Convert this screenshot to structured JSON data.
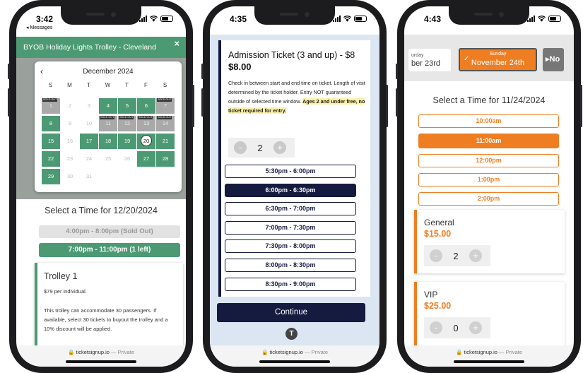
{
  "phone1": {
    "status": {
      "time": "3:42",
      "back_app": "◂ Messages"
    },
    "header": {
      "title": "BYOB Holiday Lights Trolley - Cleveland",
      "close": "×"
    },
    "calendar": {
      "month": "December 2024",
      "prev": "‹",
      "weekdays": [
        "S",
        "M",
        "T",
        "W",
        "T",
        "F",
        "S"
      ],
      "sold_out_label": "SOLD OUT",
      "days": [
        "1",
        "2",
        "3",
        "4",
        "5",
        "6",
        "7",
        "8",
        "9",
        "10",
        "11",
        "12",
        "13",
        "14",
        "15",
        "16",
        "17",
        "18",
        "19",
        "20",
        "21",
        "22",
        "23",
        "24",
        "25",
        "26",
        "27",
        "28",
        "29",
        "30",
        "31"
      ]
    },
    "select_time": "Select a Time for 12/20/2024",
    "slots": {
      "soldout": "4:00pm - 8:00pm (Sold Out)",
      "available": "7:00pm - 11:00pm (1 left)"
    },
    "trolley": {
      "title": "Trolley 1",
      "price_note": "$79 per individual.",
      "desc": "This trolley can accommodate 30 passengers. If available, select 30 tickets to buyout the trolley and a 10% discount will be applied."
    },
    "url": {
      "domain": "ticketsignup.io",
      "suffix": "— Private"
    }
  },
  "phone2": {
    "status": {
      "time": "4:35"
    },
    "ticket": {
      "title": "Admission Ticket (3 and up) - $8",
      "price": "$8.00",
      "desc": "Check in between start and end time on ticket. Length of visit determined by the ticket holder. Entry NOT guaranteed outside of selected time window.",
      "highlight": "Ages 2 and under free, no ticket required for entry."
    },
    "quantity": {
      "minus": "-",
      "value": "2",
      "plus": "+"
    },
    "slots": [
      "5:30pm - 6:00pm",
      "6:00pm - 6:30pm",
      "6:30pm - 7:00pm",
      "7:00pm - 7:30pm",
      "7:30pm - 8:00pm",
      "8:00pm - 8:30pm",
      "8:30pm - 9:00pm"
    ],
    "continue": "Continue",
    "logo": "T",
    "url": {
      "domain": "ticketsignup.io",
      "suffix": "— Private"
    }
  },
  "phone3": {
    "status": {
      "time": "4:43"
    },
    "dates": {
      "prev": {
        "sub": "urday",
        "date": "ber 23rd"
      },
      "current": {
        "sub": "Sunday",
        "date": "November 24th"
      },
      "next": {
        "date": "No"
      }
    },
    "select_time": "Select a Time for 11/24/2024",
    "slots": [
      "10:00am",
      "11:00am",
      "12:00pm",
      "1:00pm",
      "2:00pm"
    ],
    "tickets": [
      {
        "name": "General",
        "price": "$15.00",
        "qty": "2"
      },
      {
        "name": "VIP",
        "price": "$25.00",
        "qty": "0"
      }
    ],
    "stepper": {
      "minus": "-",
      "plus": "+"
    },
    "url": {
      "domain": "ticketsignup.io",
      "suffix": "— Private"
    }
  },
  "colors": {
    "green": "#4c9a74",
    "navy": "#151a3f",
    "orange": "#ef7e22"
  }
}
